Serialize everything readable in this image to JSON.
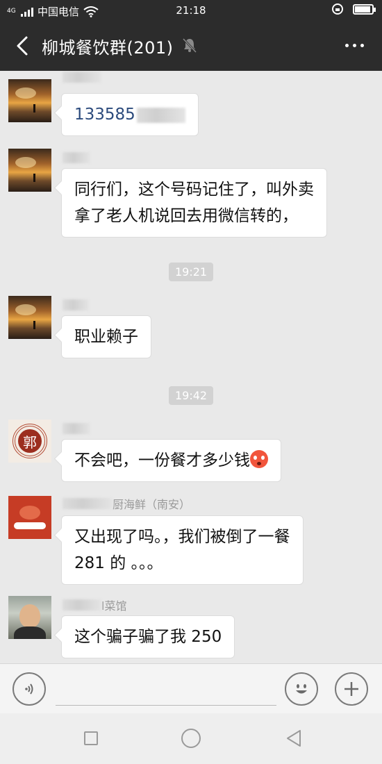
{
  "status_bar": {
    "network_type": "4G",
    "carrier": "中国电信",
    "time": "21:18",
    "battery_level": 0.9
  },
  "header": {
    "title": "柳城餐饮群(201)",
    "back_icon": "chevron-left-icon",
    "mute_icon": "bell-slash-icon",
    "more_icon": "more-dots-icon"
  },
  "messages": [
    {
      "sender": "",
      "text_visible": "133585",
      "redacted_tail": true
    },
    {
      "sender": "",
      "text": "同行们，这个号码记住了，叫外卖\n拿了老人机说回去用微信转的，"
    },
    {
      "timestamp": "19:21"
    },
    {
      "sender": "",
      "text": "职业赖子"
    },
    {
      "timestamp": "19:42"
    },
    {
      "sender": "",
      "text": "不会吧，一份餐才多少钱",
      "emoji": "flushed-emoji"
    },
    {
      "sender": "厨海鲜（南安）",
      "text": "又出现了吗。，我们被倒了一餐\n281 的 。。。"
    },
    {
      "sender": "l菜馆",
      "text": "这个骗子骗了我 250"
    }
  ],
  "avatars": {
    "guo_char": "郭"
  },
  "input_bar": {
    "voice_icon": "voice-icon",
    "emoji_icon": "smiley-icon",
    "plus_icon": "plus-icon"
  },
  "system_nav": {
    "recent_icon": "square-icon",
    "home_icon": "circle-icon",
    "back_icon": "triangle-back-icon"
  }
}
